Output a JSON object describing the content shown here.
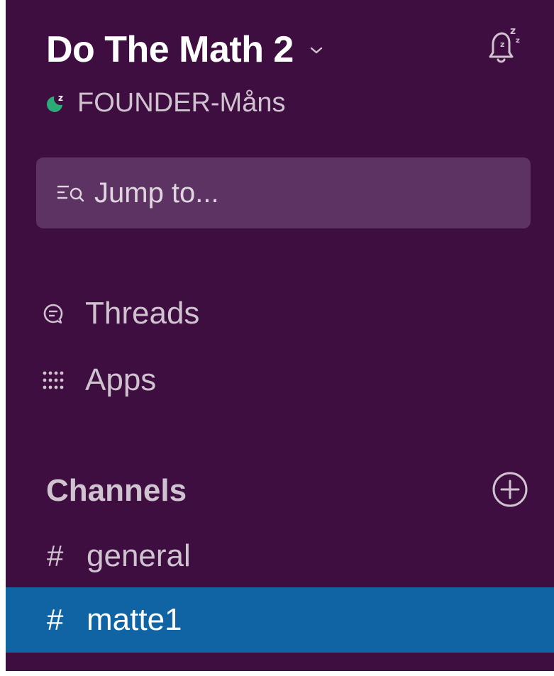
{
  "workspace": {
    "name": "Do The Math 2",
    "user": "FOUNDER-Måns"
  },
  "search": {
    "label": "Jump to..."
  },
  "nav": {
    "threads": "Threads",
    "apps": "Apps"
  },
  "channels": {
    "title": "Channels",
    "items": [
      {
        "label": "general",
        "hash": "#"
      },
      {
        "label": "matte1",
        "hash": "#"
      }
    ]
  },
  "colors": {
    "sidebar_bg": "#3f0e40",
    "active_bg": "#1164a3",
    "search_bg": "#5c3362",
    "presence_green": "#2bac76"
  },
  "icons": [
    "chevron-down-icon",
    "bell-snooze-icon",
    "presence-snooze-icon",
    "jump-to-icon",
    "threads-icon",
    "apps-grid-icon",
    "add-circle-icon"
  ]
}
